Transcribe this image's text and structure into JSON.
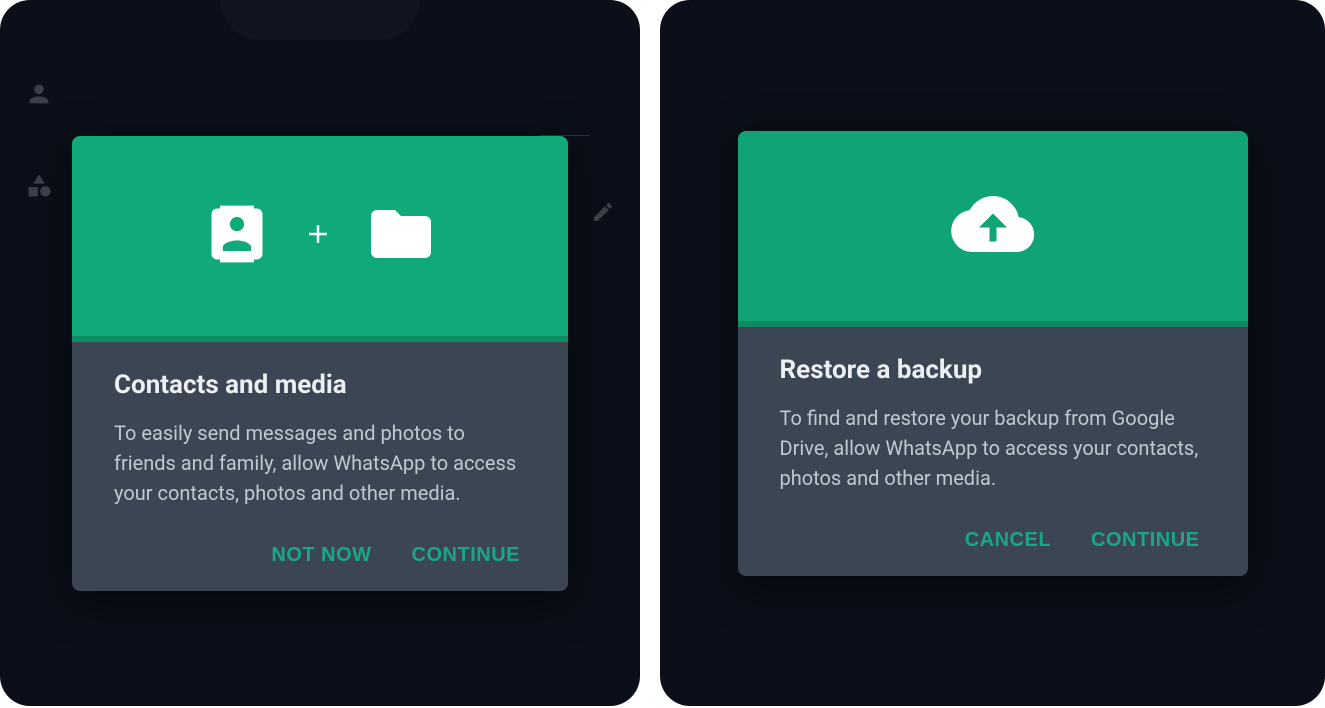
{
  "dialogs": {
    "contacts": {
      "title": "Contacts and media",
      "body": "To easily send messages and photos to friends and family, allow WhatsApp to access your contacts, photos and other media.",
      "secondary_action": "NOT NOW",
      "primary_action": "CONTINUE"
    },
    "restore": {
      "title": "Restore a backup",
      "body": "To find and restore your backup from Google Drive, allow WhatsApp to access your contacts, photos and other media.",
      "secondary_action": "CANCEL",
      "primary_action": "CONTINUE"
    }
  },
  "colors": {
    "accent_green": "#10a97a",
    "dialog_bg": "#3b4554",
    "frame_bg": "#0a0f19",
    "button_text": "#1aa884"
  }
}
